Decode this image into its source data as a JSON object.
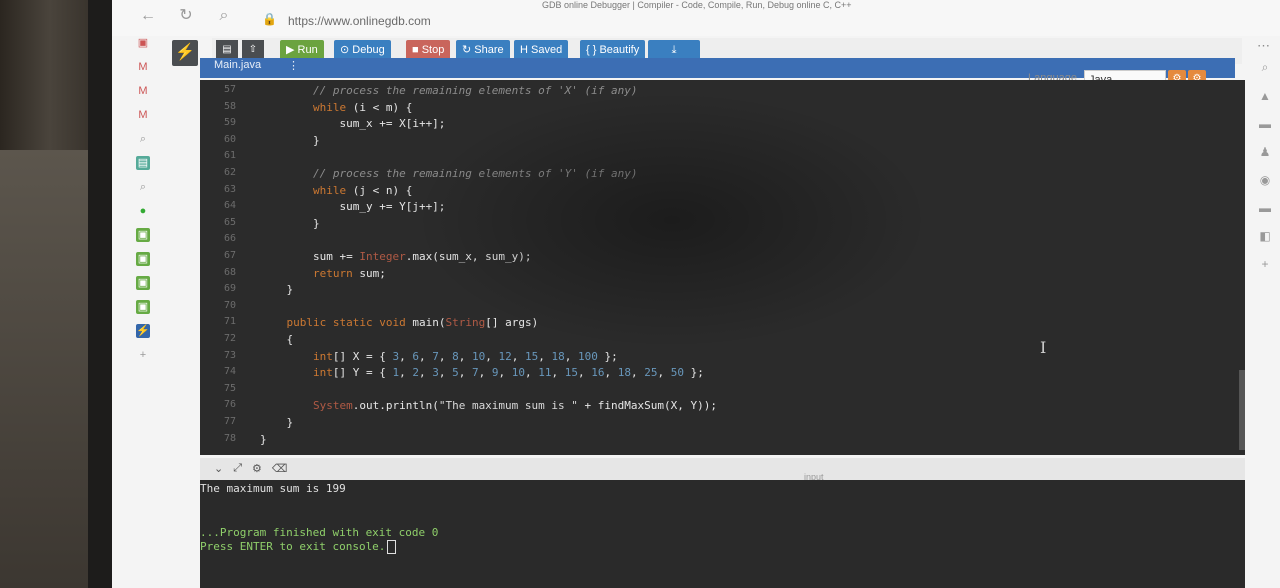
{
  "browser": {
    "tab_title": "GDB online Debugger | Compiler - Code, Compile, Run, Debug online C, C++",
    "url": "https://www.onlinegdb.com"
  },
  "toolbar": {
    "run": "▶ Run",
    "debug": "⊙ Debug",
    "stop": "■ Stop",
    "share": "↻ Share",
    "saved": "H Saved",
    "beautify": "{ } Beautify",
    "download": "⤓"
  },
  "file_tab": {
    "name": "Main.java",
    "menu": "⋮"
  },
  "language": {
    "label": "Language",
    "value": "Java"
  },
  "editor": {
    "lines": [
      {
        "n": "57",
        "text": "        // process the remaining elements of 'X' (if any)"
      },
      {
        "n": "58",
        "text": "        while (i < m) {"
      },
      {
        "n": "59",
        "text": "            sum_x += X[i++];"
      },
      {
        "n": "60",
        "text": "        }"
      },
      {
        "n": "61",
        "text": ""
      },
      {
        "n": "62",
        "text": "        // process the remaining elements of 'Y' (if any)"
      },
      {
        "n": "63",
        "text": "        while (j < n) {"
      },
      {
        "n": "64",
        "text": "            sum_y += Y[j++];"
      },
      {
        "n": "65",
        "text": "        }"
      },
      {
        "n": "66",
        "text": ""
      },
      {
        "n": "67",
        "text": "        sum += Integer.max(sum_x, sum_y);"
      },
      {
        "n": "68",
        "text": "        return sum;"
      },
      {
        "n": "69",
        "text": "    }"
      },
      {
        "n": "70",
        "text": ""
      },
      {
        "n": "71",
        "text": "    public static void main(String[] args)"
      },
      {
        "n": "72",
        "text": "    {"
      },
      {
        "n": "73",
        "text": "        int[] X = { 3, 6, 7, 8, 10, 12, 15, 18, 100 };"
      },
      {
        "n": "74",
        "text": "        int[] Y = { 1, 2, 3, 5, 7, 9, 10, 11, 15, 16, 18, 25, 50 };"
      },
      {
        "n": "75",
        "text": ""
      },
      {
        "n": "76",
        "text": "        System.out.println(\"The maximum sum is \" + findMaxSum(X, Y));"
      },
      {
        "n": "77",
        "text": "    }"
      },
      {
        "n": "78",
        "text": "}"
      }
    ]
  },
  "console": {
    "input_label": "input",
    "output": "The maximum sum is 199",
    "finished": "...Program finished with exit code 0",
    "press": "Press ENTER to exit console."
  }
}
